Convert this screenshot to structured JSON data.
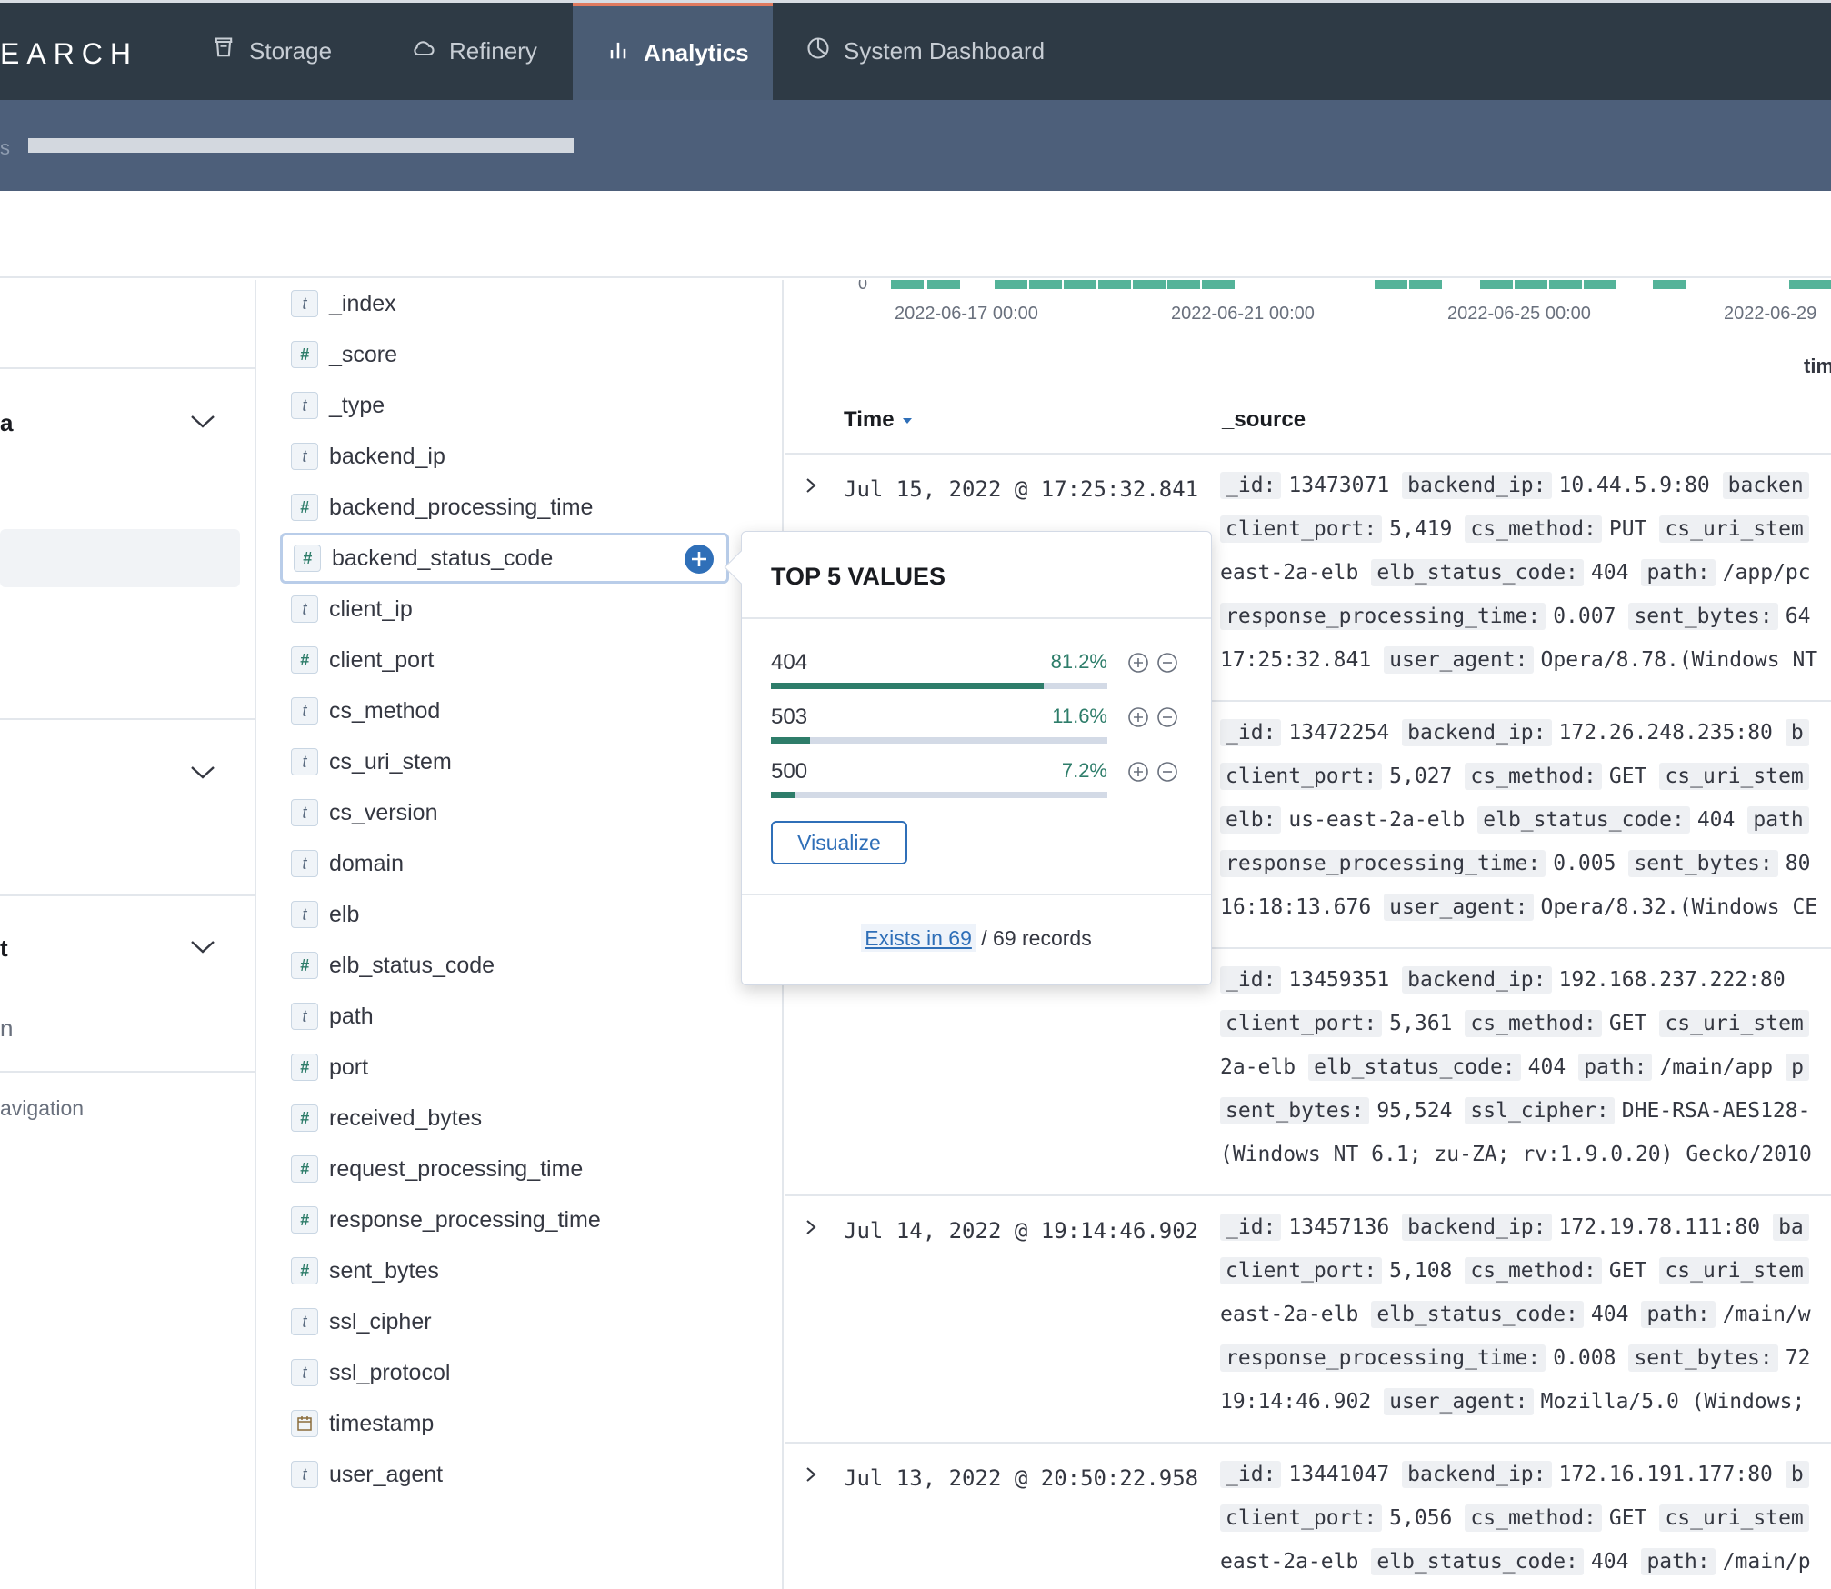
{
  "topbar": {
    "brand_partial": "EARCH",
    "tabs": [
      {
        "label": "Storage",
        "icon": "storage-icon"
      },
      {
        "label": "Refinery",
        "icon": "cloud-icon"
      },
      {
        "label": "Analytics",
        "icon": "bar-chart-icon",
        "active": true
      },
      {
        "label": "System Dashboard",
        "icon": "dashboard-icon"
      }
    ]
  },
  "subbar": {
    "text_partial": "s"
  },
  "leftnav": {
    "section1_partial": "a",
    "section3_partial": "t",
    "item_partial": "n",
    "navigation_partial": "avigation"
  },
  "fields": [
    {
      "type": "t",
      "name": "_index"
    },
    {
      "type": "#",
      "name": "_score"
    },
    {
      "type": "t",
      "name": "_type"
    },
    {
      "type": "t",
      "name": "backend_ip"
    },
    {
      "type": "#",
      "name": "backend_processing_time"
    },
    {
      "type": "#",
      "name": "backend_status_code",
      "selected": true
    },
    {
      "type": "t",
      "name": "client_ip"
    },
    {
      "type": "#",
      "name": "client_port"
    },
    {
      "type": "t",
      "name": "cs_method"
    },
    {
      "type": "t",
      "name": "cs_uri_stem"
    },
    {
      "type": "t",
      "name": "cs_version"
    },
    {
      "type": "t",
      "name": "domain"
    },
    {
      "type": "t",
      "name": "elb"
    },
    {
      "type": "#",
      "name": "elb_status_code"
    },
    {
      "type": "t",
      "name": "path"
    },
    {
      "type": "#",
      "name": "port"
    },
    {
      "type": "#",
      "name": "received_bytes"
    },
    {
      "type": "#",
      "name": "request_processing_time"
    },
    {
      "type": "#",
      "name": "response_processing_time"
    },
    {
      "type": "#",
      "name": "sent_bytes"
    },
    {
      "type": "t",
      "name": "ssl_cipher"
    },
    {
      "type": "t",
      "name": "ssl_protocol"
    },
    {
      "type": "date",
      "name": "timestamp"
    },
    {
      "type": "t",
      "name": "user_agent"
    }
  ],
  "histogram": {
    "y_zero": "0",
    "x_labels": [
      "2022-06-17 00:00",
      "2022-06-21 00:00",
      "2022-06-25 00:00",
      "2022-06-29"
    ],
    "x_title_partial": "tim"
  },
  "table": {
    "col_time": "Time",
    "col_source": "_source",
    "rows": [
      {
        "time": "Jul 15, 2022 @ 17:25:32.841",
        "lines": [
          [
            [
              "_id:",
              "13473071"
            ],
            [
              "backend_ip:",
              "10.44.5.9:80"
            ],
            [
              "backen",
              ""
            ]
          ],
          [
            [
              "client_port:",
              "5,419"
            ],
            [
              "cs_method:",
              "PUT"
            ],
            [
              "cs_uri_stem",
              ""
            ]
          ],
          [
            [
              "",
              "east-2a-elb"
            ],
            [
              "elb_status_code:",
              "404"
            ],
            [
              "path:",
              "/app/pc"
            ]
          ],
          [
            [
              "response_processing_time:",
              "0.007"
            ],
            [
              "sent_bytes:",
              "64"
            ]
          ],
          [
            [
              "",
              "17:25:32.841"
            ],
            [
              "user_agent:",
              "Opera/8.78.(Windows NT"
            ]
          ]
        ]
      },
      {
        "time": "",
        "lines": [
          [
            [
              "_id:",
              "13472254"
            ],
            [
              "backend_ip:",
              "172.26.248.235:80"
            ],
            [
              "b",
              ""
            ]
          ],
          [
            [
              "client_port:",
              "5,027"
            ],
            [
              "cs_method:",
              "GET"
            ],
            [
              "cs_uri_stem",
              ""
            ]
          ],
          [
            [
              "elb:",
              "us-east-2a-elb"
            ],
            [
              "elb_status_code:",
              "404"
            ],
            [
              "path",
              ""
            ]
          ],
          [
            [
              "response_processing_time:",
              "0.005"
            ],
            [
              "sent_bytes:",
              "80"
            ]
          ],
          [
            [
              "",
              "16:18:13.676"
            ],
            [
              "user_agent:",
              "Opera/8.32.(Windows CE"
            ]
          ]
        ]
      },
      {
        "time": "",
        "lines": [
          [
            [
              "_id:",
              "13459351"
            ],
            [
              "backend_ip:",
              "192.168.237.222:80"
            ]
          ],
          [
            [
              "client_port:",
              "5,361"
            ],
            [
              "cs_method:",
              "GET"
            ],
            [
              "cs_uri_stem",
              ""
            ]
          ],
          [
            [
              "",
              "2a-elb"
            ],
            [
              "elb_status_code:",
              "404"
            ],
            [
              "path:",
              "/main/app"
            ],
            [
              "p",
              ""
            ]
          ],
          [
            [
              "sent_bytes:",
              "95,524"
            ],
            [
              "ssl_cipher:",
              "DHE-RSA-AES128-"
            ]
          ],
          [
            [
              "",
              "(Windows NT 6.1; zu-ZA; rv:1.9.0.20) Gecko/2010"
            ]
          ]
        ]
      },
      {
        "time": "Jul 14, 2022 @ 19:14:46.902",
        "lines": [
          [
            [
              "_id:",
              "13457136"
            ],
            [
              "backend_ip:",
              "172.19.78.111:80"
            ],
            [
              "ba",
              ""
            ]
          ],
          [
            [
              "client_port:",
              "5,108"
            ],
            [
              "cs_method:",
              "GET"
            ],
            [
              "cs_uri_stem",
              ""
            ]
          ],
          [
            [
              "",
              "east-2a-elb"
            ],
            [
              "elb_status_code:",
              "404"
            ],
            [
              "path:",
              "/main/w"
            ]
          ],
          [
            [
              "response_processing_time:",
              "0.008"
            ],
            [
              "sent_bytes:",
              "72"
            ]
          ],
          [
            [
              "",
              "19:14:46.902"
            ],
            [
              "user_agent:",
              "Mozilla/5.0 (Windows;"
            ]
          ]
        ]
      },
      {
        "time": "Jul 13, 2022 @ 20:50:22.958",
        "lines": [
          [
            [
              "_id:",
              "13441047"
            ],
            [
              "backend_ip:",
              "172.16.191.177:80"
            ],
            [
              "b",
              ""
            ]
          ],
          [
            [
              "client_port:",
              "5,056"
            ],
            [
              "cs_method:",
              "GET"
            ],
            [
              "cs_uri_stem",
              ""
            ]
          ],
          [
            [
              "",
              "east-2a-elb"
            ],
            [
              "elb_status_code:",
              "404"
            ],
            [
              "path:",
              "/main/p"
            ]
          ]
        ]
      }
    ]
  },
  "popover": {
    "title": "TOP 5 VALUES",
    "values": [
      {
        "value": "404",
        "percent": "81.2%",
        "fraction": 0.812
      },
      {
        "value": "503",
        "percent": "11.6%",
        "fraction": 0.116
      },
      {
        "value": "500",
        "percent": "7.2%",
        "fraction": 0.072
      }
    ],
    "visualize_label": "Visualize",
    "exists_link": "Exists in 69",
    "exists_rest": " / 69 records"
  },
  "colors": {
    "topbar": "#2e3a45",
    "active_tab": "#4a5c74",
    "accent": "#2f6fb8",
    "bar_green": "#54b399",
    "value_green": "#2e7d6a"
  }
}
